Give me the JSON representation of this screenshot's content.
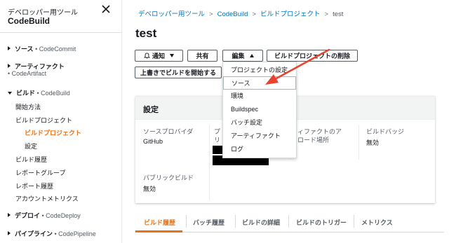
{
  "sidebar": {
    "service": "デベロッパー用ツール",
    "app": "CodeBuild",
    "sections": [
      {
        "title": "ソース",
        "sub": "CodeCommit"
      },
      {
        "title": "アーティファクト",
        "sub": "CodeArtifact"
      },
      {
        "title": "ビルド",
        "sub": "CodeBuild"
      },
      {
        "title": "デプロイ",
        "sub": "CodeDeploy"
      },
      {
        "title": "パイプライン",
        "sub": "CodePipeline"
      }
    ],
    "build_items": [
      "開始方法",
      "ビルドプロジェクト",
      "ビルドプロジェクト",
      "設定",
      "ビルド履歴",
      "レポートグループ",
      "レポート履歴",
      "アカウントメトリクス"
    ]
  },
  "breadcrumb": [
    "デベロッパー用ツール",
    "CodeBuild",
    "ビルドプロジェクト",
    "test"
  ],
  "page_title": "test",
  "buttons": {
    "notify": "通知",
    "share": "共有",
    "edit": "編集",
    "delete": "ビルドプロジェクトの削除",
    "override": "上書きでビルドを開始する"
  },
  "edit_menu": [
    "プロジェクトの設定",
    "ソース",
    "環境",
    "Buildspec",
    "バッチ設定",
    "アーティファクト",
    "ログ"
  ],
  "panel": {
    "title": "設定",
    "fields": [
      {
        "label": "ソースプロバイダ",
        "value": "GitHub"
      },
      {
        "label": "プ",
        "value": ""
      },
      {
        "label": "リ",
        "value": ""
      },
      {
        "label": "ィファクトのア",
        "value": ""
      },
      {
        "label": "ロード場所",
        "value": ""
      },
      {
        "label": "ビルドバッジ",
        "value": "無効"
      },
      {
        "label": "パブリックビルド",
        "value": "無効"
      }
    ]
  },
  "tabs": [
    "ビルド履歴",
    "バッチ履歴",
    "ビルドの詳細",
    "ビルドのトリガー",
    "メトリクス"
  ],
  "colors": {
    "accent": "#ec7211",
    "link": "#0073bb",
    "arrow": "#e8432f"
  }
}
